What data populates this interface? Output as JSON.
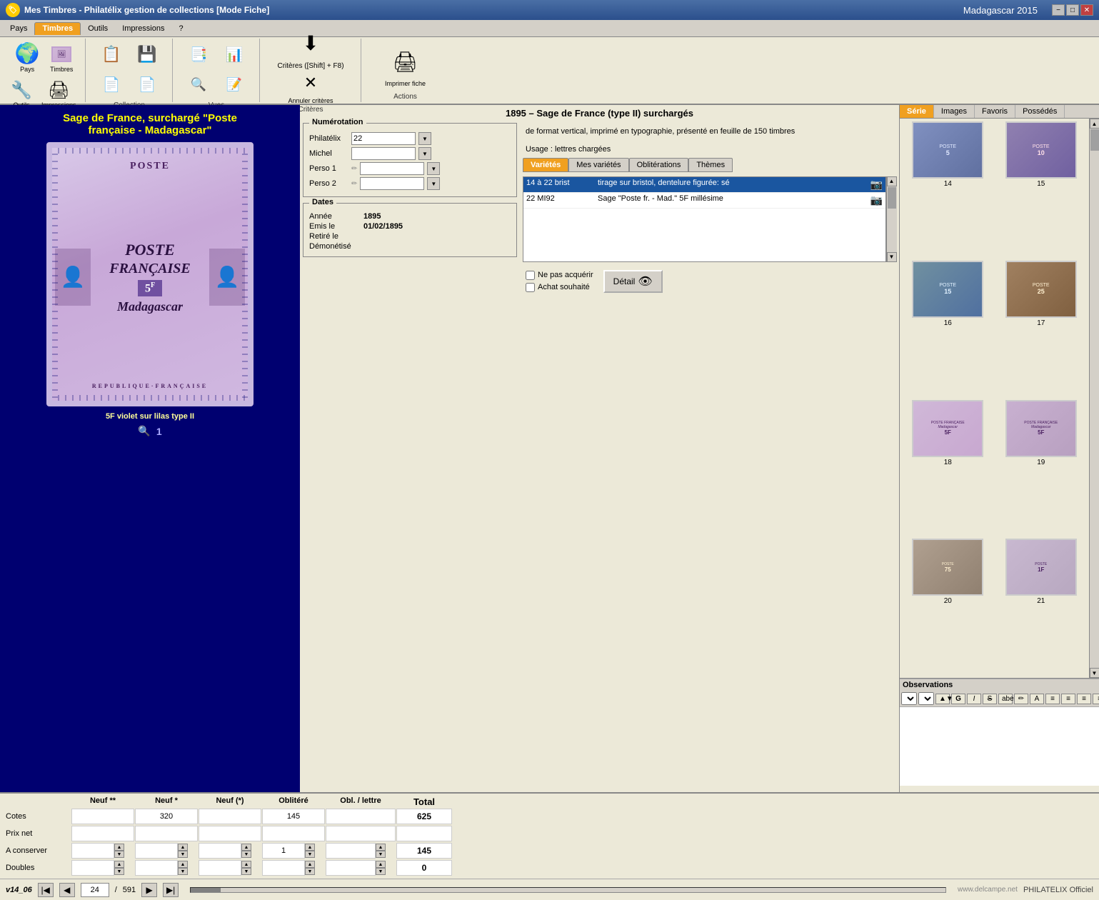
{
  "titlebar": {
    "title": "Mes Timbres - Philatélix gestion de collections [Mode Fiche]",
    "right_title": "Madagascar 2015",
    "min": "−",
    "max": "□",
    "close": "✕"
  },
  "menubar": {
    "items": [
      "Pays",
      "Timbres",
      "Outils",
      "Impressions",
      "?"
    ],
    "active": "Timbres"
  },
  "toolbar": {
    "sections": [
      {
        "label": "",
        "buttons": [
          {
            "name": "pays-btn",
            "icon": "🌍",
            "label": "Pays"
          },
          {
            "name": "timbres-btn",
            "icon": "🖼",
            "label": "Timbres"
          },
          {
            "name": "outils-btn",
            "icon": "🔧",
            "label": "Outils"
          },
          {
            "name": "impressions-btn",
            "icon": "🖨",
            "label": "Impressions"
          }
        ]
      },
      {
        "label": "Collection"
      },
      {
        "label": "Vues"
      },
      {
        "label": "Critères",
        "main_btn": "Critères ([Shift] + F8)",
        "cancel_btn": "Annuler critères"
      },
      {
        "label": "Actions",
        "print_btn": "Imprimer fiche"
      }
    ]
  },
  "series_title": "1895 – Sage de France (type II) surchargés",
  "stamp": {
    "title_line1": "Sage de France, surchargé \"Poste",
    "title_line2": "française - Madagascar\"",
    "subtitle": "5F violet sur lilas type II",
    "value": "5F",
    "republic": "REPUBLIQUE·FRANÇAISE"
  },
  "numerotation": {
    "legend": "Numérotation",
    "philatelix_label": "Philatélix",
    "philatelix_value": "22",
    "michel_label": "Michel",
    "michel_value": "",
    "perso1_label": "Perso 1",
    "perso1_value": "",
    "perso2_label": "Perso 2",
    "perso2_value": ""
  },
  "dates": {
    "legend": "Dates",
    "annee_label": "Année",
    "annee_value": "1895",
    "emis_label": "Emis le",
    "emis_value": "01/02/1895",
    "retire_label": "Retiré le",
    "retire_value": "",
    "demonetise_label": "Démonétisé",
    "demonetise_value": ""
  },
  "description": {
    "text": "de format vertical, imprimé en typographie, présenté en feuille de 150 timbres",
    "usage_label": "Usage :",
    "usage_value": "lettres chargées"
  },
  "tabs": {
    "varietes": "Variétés",
    "mes_varietes": "Mes variétés",
    "obliterations": "Oblitérations",
    "themes": "Thèmes",
    "active": "Variétés"
  },
  "varietes": [
    {
      "code": "14 à 22 brist",
      "desc": "tirage sur bristol, dentelure figurée: sé",
      "selected": true
    },
    {
      "code": "22 MI92",
      "desc": "Sage \"Poste fr. - Mad.\" 5F millésime",
      "selected": false
    }
  ],
  "right_tabs": [
    "Série",
    "Images",
    "Favoris",
    "Possédés"
  ],
  "right_active_tab": "Série",
  "stamp_series": [
    {
      "num": "14"
    },
    {
      "num": "15"
    },
    {
      "num": "16"
    },
    {
      "num": "17"
    },
    {
      "num": "18"
    },
    {
      "num": "19"
    },
    {
      "num": "20"
    },
    {
      "num": "21"
    }
  ],
  "price_table": {
    "headers": [
      "",
      "Neuf **",
      "Neuf *",
      "Neuf (*)",
      "Oblitéré",
      "Obl. / lettre",
      "Total"
    ],
    "rows": [
      {
        "label": "Cotes",
        "neuf2": "",
        "neuf1": "320",
        "neuf_p": "",
        "oblitere": "145",
        "obl_lettre": "",
        "total": "625"
      },
      {
        "label": "Prix net",
        "neuf2": "",
        "neuf1": "",
        "neuf_p": "",
        "oblitere": "",
        "obl_lettre": "",
        "total": ""
      },
      {
        "label": "A conserver",
        "neuf2": "",
        "neuf1": "",
        "neuf_p": "",
        "oblitere": "1",
        "obl_lettre": "",
        "total": "145"
      },
      {
        "label": "Doubles",
        "neuf2": "",
        "neuf1": "",
        "neuf_p": "",
        "oblitere": "",
        "obl_lettre": "",
        "total": "0"
      }
    ]
  },
  "checkboxes": {
    "ne_pas_acquerir": "Ne pas acquérir",
    "achat_souhaite": "Achat souhaité"
  },
  "detail_btn": "Détail",
  "observations": {
    "label": "Observations",
    "toolbar_items": [
      "▼",
      "▼",
      "▲▼",
      "G",
      "I",
      "S",
      "abe",
      "✏",
      "A",
      "≡",
      "≡",
      "≡",
      "≡"
    ]
  },
  "navigation": {
    "version": "v14_06",
    "current": "24",
    "total": "591",
    "website": "www.delcampe.net",
    "philatelix": "PHILATELIX Officiel"
  },
  "colors": {
    "orange": "#f0a020",
    "blue_title": "#000070",
    "yellow_text": "#ffff00",
    "selected_row": "#1a56a0"
  }
}
